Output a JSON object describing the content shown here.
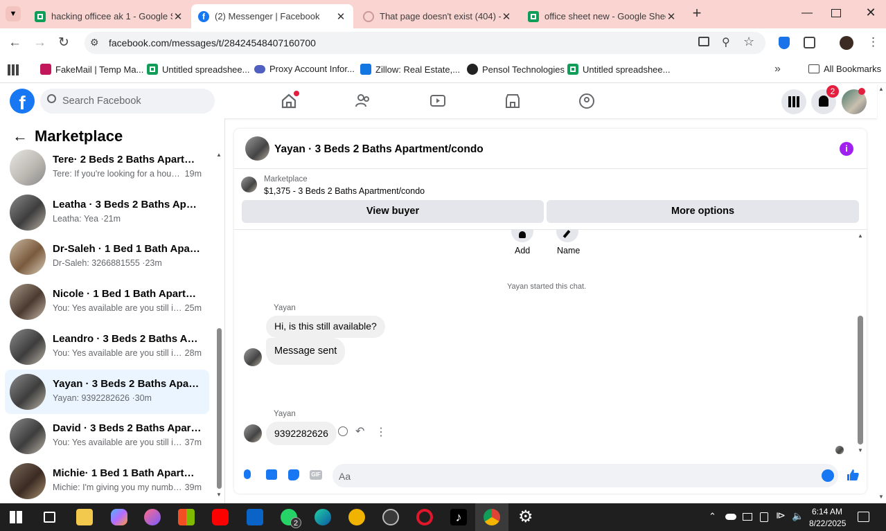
{
  "browser": {
    "tabs": [
      {
        "title": "hacking officee ak 1 - Google S",
        "icon": "sheets-icon"
      },
      {
        "title": "(2) Messenger | Facebook",
        "icon": "facebook-icon"
      },
      {
        "title": "That page doesn't exist (404) - I",
        "icon": "error-icon"
      },
      {
        "title": "office sheet new - Google Shee",
        "icon": "sheets-icon"
      }
    ],
    "url": "facebook.com/messages/t/28424548407160700",
    "bookmarks": [
      {
        "label": "FakeMail | Temp Ma..."
      },
      {
        "label": "Untitled spreadshee..."
      },
      {
        "label": "Proxy Account Infor..."
      },
      {
        "label": "Zillow: Real Estate,..."
      },
      {
        "label": "Pensol Technologies"
      },
      {
        "label": "Untitled spreadshee..."
      }
    ],
    "all_bookmarks": "All Bookmarks"
  },
  "facebook": {
    "search_placeholder": "Search Facebook",
    "notification_count": "2",
    "colors": {
      "brand": "#1877f2",
      "badge": "#e41e3f"
    }
  },
  "sidebar": {
    "title": "Marketplace",
    "conversations": [
      {
        "title": "Tere· 2 Beds 2 Baths Apartment/...",
        "snippet": "Tere: If you're looking for a house...",
        "time": "19m"
      },
      {
        "title": "Leatha · 3 Beds 2 Baths Apartm...",
        "snippet": "Leatha: Yea ·",
        "time": "21m"
      },
      {
        "title": "Dr-Saleh · 1 Bed 1 Bath Apartme...",
        "snippet": "Dr-Saleh: 3266881555 ·",
        "time": "23m"
      },
      {
        "title": "Nicole · 1 Bed 1 Bath Apartment...",
        "snippet": "You: Yes available are you still int...",
        "time": "25m"
      },
      {
        "title": "Leandro · 3 Beds 2 Baths Apart...",
        "snippet": "You: Yes available are you still int...",
        "time": "28m"
      },
      {
        "title": "Yayan · 3 Beds 2 Baths Apartme...",
        "snippet": "Yayan: 9392282626 ·",
        "time": "30m"
      },
      {
        "title": "David · 3 Beds 2 Baths Apartme...",
        "snippet": "You: Yes available are you still int...",
        "time": "37m"
      },
      {
        "title": "Michie· 1 Bed 1 Bath Apartment/...",
        "snippet": "Michie: I'm giving you my numbe...",
        "time": "39m"
      }
    ]
  },
  "chat": {
    "title": "Yayan · 3 Beds 2 Baths Apartment/condo",
    "listing_source": "Marketplace",
    "listing_price_title": "$1,375 - 3 Beds 2 Baths Apartment/condo",
    "view_buyer": "View buyer",
    "more_options": "More options",
    "add_label": "Add",
    "name_label": "Name",
    "started_text": "Yayan started this chat.",
    "messages": [
      {
        "sender": "Yayan",
        "text": "Hi, is this still available?"
      },
      {
        "text": "Message sent"
      },
      {
        "sender": "Yayan",
        "text": "9392282626"
      }
    ],
    "composer_placeholder": "Aa"
  },
  "taskbar": {
    "time": "6:14 AM",
    "date": "8/22/2025",
    "whatsapp_badge": "2"
  }
}
